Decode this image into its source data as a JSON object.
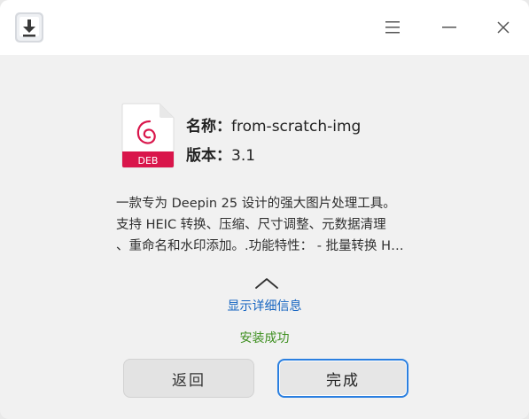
{
  "titlebar": {
    "app_icon": "package-download-icon",
    "menu_icon": "menu-icon",
    "minimize_icon": "minimize-icon",
    "close_icon": "close-icon"
  },
  "package": {
    "icon": "deb-package-icon",
    "icon_badge": "DEB",
    "name_label": "名称：",
    "name_value": "from-scratch-img",
    "version_label": "版本：",
    "version_value": "3.1"
  },
  "description": {
    "lines": [
      "一款专为 Deepin 25 设计的强大图片处理工具。",
      "支持 HEIC 转换、压缩、尺寸调整、元数据清理",
      "、重命名和水印添加。.功能特性： - 批量转换 H…"
    ]
  },
  "details": {
    "toggle_icon": "chevron-up-icon",
    "link_text": "显示详细信息"
  },
  "status_text": "安装成功",
  "buttons": {
    "back_label": "返回",
    "done_label": "完成"
  },
  "colors": {
    "link": "#1665c1",
    "success": "#3e8f20",
    "deb_accent": "#d9164b",
    "focus_border": "#2a7fe0"
  }
}
